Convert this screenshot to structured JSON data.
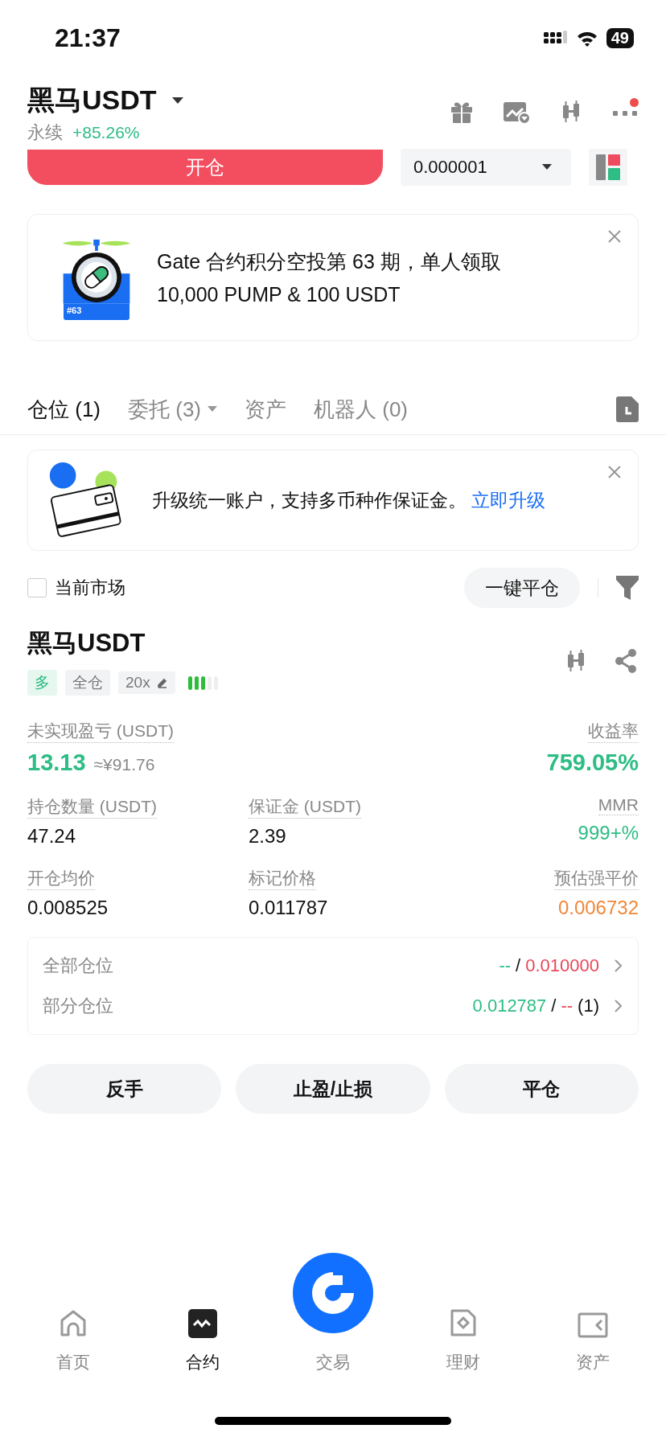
{
  "status_bar": {
    "time": "21:37",
    "battery": "49"
  },
  "header": {
    "title": "黑马USDT",
    "contract_type": "永续",
    "change": "+85.26%",
    "notification_dot": true
  },
  "order_bar": {
    "open_button": "开仓",
    "precision": "0.000001"
  },
  "promo_banner": {
    "badge": "#63",
    "lines": [
      "Gate 合约积分空投第 63 期，单人领取",
      "10,000 PUMP & 100 USDT"
    ]
  },
  "tabs": [
    {
      "label": "仓位 (1)",
      "selected": true,
      "dropdown": false
    },
    {
      "label": "委托 (3)",
      "selected": false,
      "dropdown": true
    },
    {
      "label": "资产",
      "selected": false,
      "dropdown": false
    },
    {
      "label": "机器人 (0)",
      "selected": false,
      "dropdown": false
    }
  ],
  "upgrade_banner": {
    "text": "升级统一账户，支持多币种作保证金。",
    "link": "立即升级"
  },
  "filter": {
    "label": "当前市场",
    "checked": false,
    "close_all_button": "一键平仓"
  },
  "position": {
    "symbol": "黑马USDT",
    "side": "多",
    "margin_mode": "全仓",
    "leverage": "20x",
    "level": 0.6,
    "metric_rows": [
      {
        "kind": "headline",
        "cells": [
          {
            "label": "未实现盈亏 (USDT)",
            "value": "13.13",
            "sub": "≈¥91.76",
            "color": "#2dbd85"
          },
          {
            "label": "收益率",
            "value": "759.05%",
            "color": "#2dbd85"
          }
        ]
      },
      {
        "kind": "standard",
        "cells": [
          {
            "label": "持仓数量 (USDT)",
            "value": "47.24",
            "color": "#111111"
          },
          {
            "label": "保证金 (USDT)",
            "value": "2.39",
            "color": "#111111"
          },
          {
            "label": "MMR",
            "value": "999+%",
            "color": "#2dbd85"
          }
        ]
      },
      {
        "kind": "standard",
        "cells": [
          {
            "label": "开仓均价",
            "value": "0.008525",
            "color": "#111111"
          },
          {
            "label": "标记价格",
            "value": "0.011787",
            "color": "#111111"
          },
          {
            "label": "预估强平价",
            "value": "0.006732",
            "color": "#f0883a"
          }
        ]
      }
    ],
    "tp_sl": [
      {
        "label": "全部仓位",
        "take_profit": "--",
        "separator": "/",
        "stop_loss": "0.010000"
      },
      {
        "label": "部分仓位",
        "take_profit": "0.012787",
        "separator": "/",
        "stop_loss": "--",
        "count": "(1)"
      }
    ],
    "actions": [
      "反手",
      "止盈/止损",
      "平仓"
    ]
  },
  "bottom_nav": [
    {
      "label": "首页",
      "selected": false,
      "kind": "tab"
    },
    {
      "label": "合约",
      "selected": true,
      "kind": "tab"
    },
    {
      "label": "交易",
      "selected": false,
      "kind": "center"
    },
    {
      "label": "理财",
      "selected": false,
      "kind": "tab"
    },
    {
      "label": "资产",
      "selected": false,
      "kind": "tab"
    }
  ]
}
